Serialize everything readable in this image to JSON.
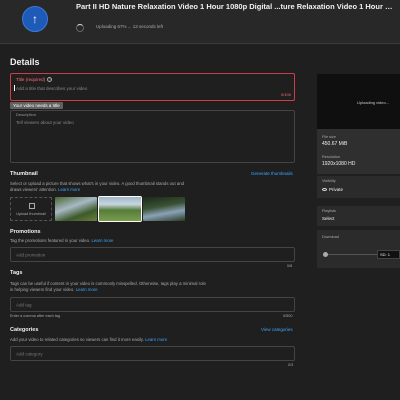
{
  "header": {
    "logo_glyph": "↑",
    "title": "Part II HD Nature Relaxation Video 1 Hour 1080p Digital ...ture Relaxation Video 1 Hour 1080p Digital ...",
    "status": "Uploading 67% ... 13 seconds left"
  },
  "page": {
    "heading": "Details"
  },
  "title_field": {
    "label": "Title (required)",
    "help": "?",
    "placeholder": "Add a title that describes your video",
    "counter": "0/100",
    "error_tooltip": "Your video needs a title"
  },
  "description_field": {
    "label": "Description",
    "placeholder": "Tell viewers about your video"
  },
  "thumbnail": {
    "title": "Thumbnail",
    "generate_link": "Generate thumbnails",
    "description": "Select or upload a picture that shows what's in your video. A good thumbnail stands out and draws viewers' attention.",
    "learn_more": "Learn more",
    "upload_label": "Upload thumbnail"
  },
  "promotions": {
    "title": "Promotions",
    "description": "Tag the promotions featured in your video.",
    "learn_more": "Learn more",
    "placeholder": "Add promotion",
    "counter": "0/8"
  },
  "tags": {
    "title": "Tags",
    "description": "Tags can be useful if content in your video is commonly misspelled. Otherwise, tags play a minimal role in helping viewers find your video.",
    "learn_more": "Learn more",
    "placeholder": "Add tag",
    "hint": "Enter a comma after each tag",
    "counter": "0/500"
  },
  "categories": {
    "title": "Categories",
    "view_link": "View categories",
    "description": "Add your video to related categories so viewers can find it more easily.",
    "learn_more": "Learn more",
    "placeholder": "Add category",
    "counter": "0/3"
  },
  "sidebar": {
    "preview_status": "Uploading video...",
    "file_size_label": "File size",
    "file_size_value": "450.67 MiB",
    "resolution_label": "Resolution",
    "resolution_value": "1920x1080 HD",
    "visibility_label": "Visibility",
    "visibility_value": "Private",
    "playlists_label": "Playlists",
    "playlists_value": "Select",
    "download_label": "Download",
    "download_select": "SD: 1"
  }
}
